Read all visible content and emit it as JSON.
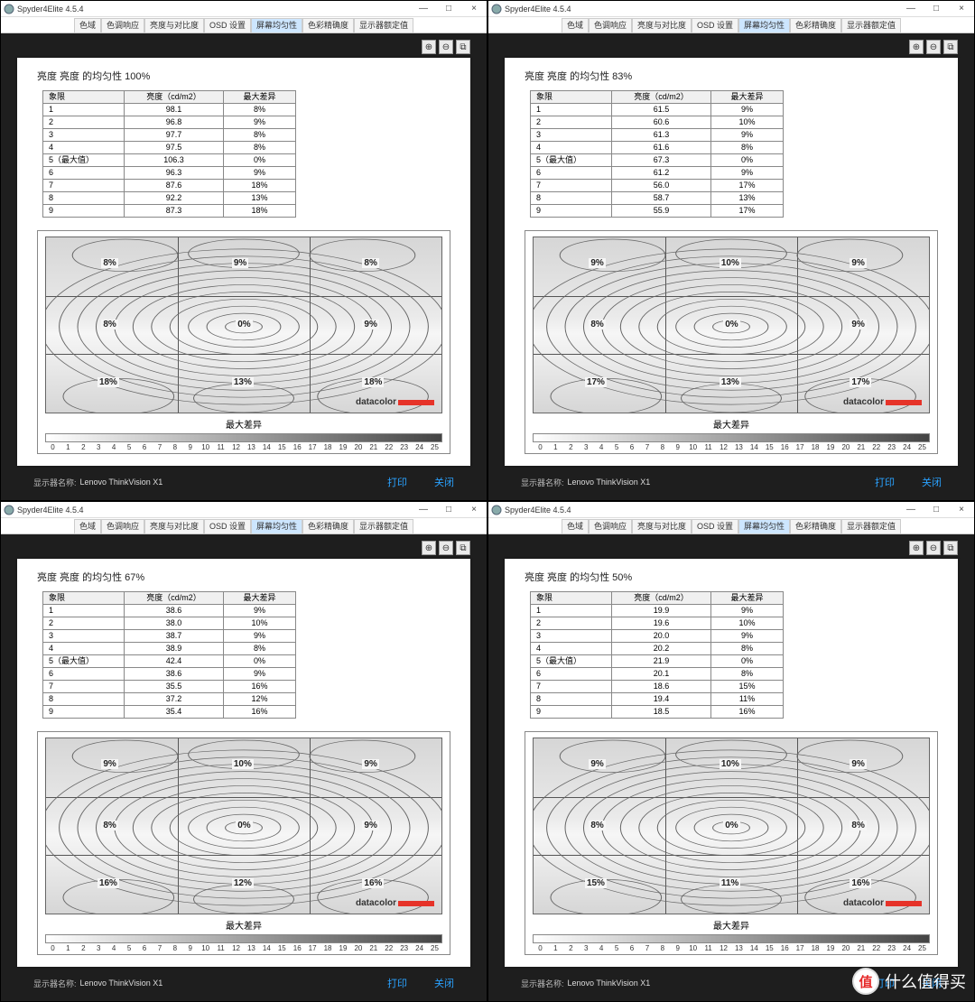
{
  "app_title": "Spyder4Elite 4.5.4",
  "win_min": "—",
  "win_max": "□",
  "win_close": "×",
  "tabs": [
    "色域",
    "色调响应",
    "亮度与对比度",
    "OSD 设置",
    "屏幕均匀性",
    "色彩精确度",
    "显示器额定值"
  ],
  "active_tab_index": 4,
  "icon_zoom_in": "⊕",
  "icon_zoom_out": "⊖",
  "icon_fit": "⧉",
  "th_quadrant": "象限",
  "th_luminance": "亮度（cd/m2）",
  "th_maxdiff": "最大差异",
  "axis_label": "最大差异",
  "brand": "datacolor",
  "scale_ticks": [
    "0",
    "1",
    "2",
    "3",
    "4",
    "5",
    "6",
    "7",
    "8",
    "9",
    "10",
    "11",
    "12",
    "13",
    "14",
    "15",
    "16",
    "17",
    "18",
    "19",
    "20",
    "21",
    "22",
    "23",
    "24",
    "25"
  ],
  "footer_label": "显示器名称:",
  "footer_value": "Lenovo ThinkVision X1",
  "btn_print": "打印",
  "btn_close": "关闭",
  "watermark_text": "什么值得买",
  "watermark_badge": "值",
  "panels": [
    {
      "title": "亮度 亮度 的均匀性 100%",
      "rows": [
        {
          "q": "1",
          "l": "98.1",
          "d": "8%"
        },
        {
          "q": "2",
          "l": "96.8",
          "d": "9%"
        },
        {
          "q": "3",
          "l": "97.7",
          "d": "8%"
        },
        {
          "q": "4",
          "l": "97.5",
          "d": "8%"
        },
        {
          "q": "5（最大值）",
          "l": "106.3",
          "d": "0%"
        },
        {
          "q": "6",
          "l": "96.3",
          "d": "9%"
        },
        {
          "q": "7",
          "l": "87.6",
          "d": "18%"
        },
        {
          "q": "8",
          "l": "92.2",
          "d": "13%"
        },
        {
          "q": "9",
          "l": "87.3",
          "d": "18%"
        }
      ],
      "grid_pct": [
        "8%",
        "9%",
        "8%",
        "8%",
        "0%",
        "9%",
        "18%",
        "13%",
        "18%"
      ]
    },
    {
      "title": "亮度 亮度 的均匀性 83%",
      "rows": [
        {
          "q": "1",
          "l": "61.5",
          "d": "9%"
        },
        {
          "q": "2",
          "l": "60.6",
          "d": "10%"
        },
        {
          "q": "3",
          "l": "61.3",
          "d": "9%"
        },
        {
          "q": "4",
          "l": "61.6",
          "d": "8%"
        },
        {
          "q": "5（最大值）",
          "l": "67.3",
          "d": "0%"
        },
        {
          "q": "6",
          "l": "61.2",
          "d": "9%"
        },
        {
          "q": "7",
          "l": "56.0",
          "d": "17%"
        },
        {
          "q": "8",
          "l": "58.7",
          "d": "13%"
        },
        {
          "q": "9",
          "l": "55.9",
          "d": "17%"
        }
      ],
      "grid_pct": [
        "9%",
        "10%",
        "9%",
        "8%",
        "0%",
        "9%",
        "17%",
        "13%",
        "17%"
      ]
    },
    {
      "title": "亮度 亮度 的均匀性 67%",
      "rows": [
        {
          "q": "1",
          "l": "38.6",
          "d": "9%"
        },
        {
          "q": "2",
          "l": "38.0",
          "d": "10%"
        },
        {
          "q": "3",
          "l": "38.7",
          "d": "9%"
        },
        {
          "q": "4",
          "l": "38.9",
          "d": "8%"
        },
        {
          "q": "5（最大值）",
          "l": "42.4",
          "d": "0%"
        },
        {
          "q": "6",
          "l": "38.6",
          "d": "9%"
        },
        {
          "q": "7",
          "l": "35.5",
          "d": "16%"
        },
        {
          "q": "8",
          "l": "37.2",
          "d": "12%"
        },
        {
          "q": "9",
          "l": "35.4",
          "d": "16%"
        }
      ],
      "grid_pct": [
        "9%",
        "10%",
        "9%",
        "8%",
        "0%",
        "9%",
        "16%",
        "12%",
        "16%"
      ]
    },
    {
      "title": "亮度 亮度 的均匀性 50%",
      "rows": [
        {
          "q": "1",
          "l": "19.9",
          "d": "9%"
        },
        {
          "q": "2",
          "l": "19.6",
          "d": "10%"
        },
        {
          "q": "3",
          "l": "20.0",
          "d": "9%"
        },
        {
          "q": "4",
          "l": "20.2",
          "d": "8%"
        },
        {
          "q": "5（最大值）",
          "l": "21.9",
          "d": "0%"
        },
        {
          "q": "6",
          "l": "20.1",
          "d": "8%"
        },
        {
          "q": "7",
          "l": "18.6",
          "d": "15%"
        },
        {
          "q": "8",
          "l": "19.4",
          "d": "11%"
        },
        {
          "q": "9",
          "l": "18.5",
          "d": "16%"
        }
      ],
      "grid_pct": [
        "9%",
        "10%",
        "9%",
        "8%",
        "0%",
        "8%",
        "15%",
        "11%",
        "16%"
      ]
    }
  ],
  "chart_data": [
    {
      "type": "heatmap",
      "title": "亮度均匀性 100%",
      "rows": 3,
      "cols": 3,
      "values": [
        [
          8,
          9,
          8
        ],
        [
          8,
          0,
          9
        ],
        [
          18,
          13,
          18
        ]
      ],
      "unit": "%",
      "scale": [
        0,
        25
      ],
      "xlabel": "最大差异"
    },
    {
      "type": "heatmap",
      "title": "亮度均匀性 83%",
      "rows": 3,
      "cols": 3,
      "values": [
        [
          9,
          10,
          9
        ],
        [
          8,
          0,
          9
        ],
        [
          17,
          13,
          17
        ]
      ],
      "unit": "%",
      "scale": [
        0,
        25
      ],
      "xlabel": "最大差异"
    },
    {
      "type": "heatmap",
      "title": "亮度均匀性 67%",
      "rows": 3,
      "cols": 3,
      "values": [
        [
          9,
          10,
          9
        ],
        [
          8,
          0,
          9
        ],
        [
          16,
          12,
          16
        ]
      ],
      "unit": "%",
      "scale": [
        0,
        25
      ],
      "xlabel": "最大差异"
    },
    {
      "type": "heatmap",
      "title": "亮度均匀性 50%",
      "rows": 3,
      "cols": 3,
      "values": [
        [
          9,
          10,
          9
        ],
        [
          8,
          0,
          8
        ],
        [
          15,
          11,
          16
        ]
      ],
      "unit": "%",
      "scale": [
        0,
        25
      ],
      "xlabel": "最大差异"
    }
  ]
}
